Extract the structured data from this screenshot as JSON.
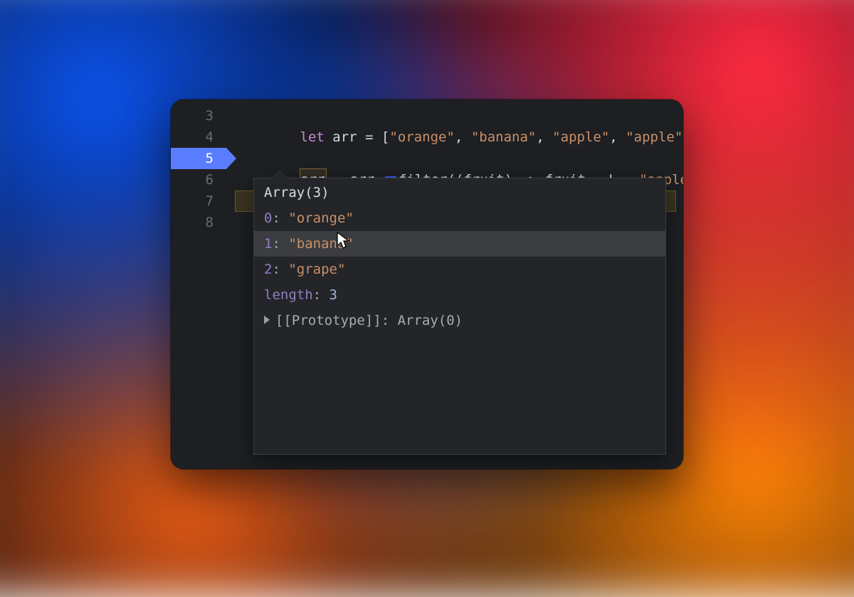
{
  "gutter": {
    "lines": {
      "l3": "3",
      "l4": "4",
      "l5": "5",
      "l6": "6",
      "l7": "7",
      "l8": "8"
    },
    "current_line": 5
  },
  "code": {
    "line3": {
      "kw": "let",
      "id": "arr",
      "eq": " = ",
      "lb": "[",
      "s1": "\"orange\"",
      "c1": ", ",
      "s2": "\"banana\"",
      "c2": ", ",
      "s3": "\"apple\"",
      "c3": ", ",
      "s4": "\"apple\"",
      "tail": ", "
    },
    "line5": {
      "lhs": "arr",
      "eq": " = ",
      "rhs_obj": "arr",
      "dot": ".",
      "fn": "filter",
      "open": "((",
      "param": "fruit",
      "arrow": ") => ",
      "param2": "fruit",
      "sp": " ",
      "op": "!==",
      "sp2": " ",
      "val": "\"apple\"",
      "close": ");"
    }
  },
  "popup": {
    "header": "Array(3)",
    "rows": [
      {
        "k": "0",
        "v": "\"orange\""
      },
      {
        "k": "1",
        "v": "\"banana\""
      },
      {
        "k": "2",
        "v": "\"grape\""
      }
    ],
    "hovered_index": 1,
    "length_label": "length",
    "length_value": "3",
    "proto_label": "[[Prototype]]",
    "proto_value": "Array(0)"
  },
  "colors": {
    "bg": "#1d1f22",
    "accent": "#5a7dff",
    "string": "#c9906a",
    "keyword": "#c68bd8"
  }
}
